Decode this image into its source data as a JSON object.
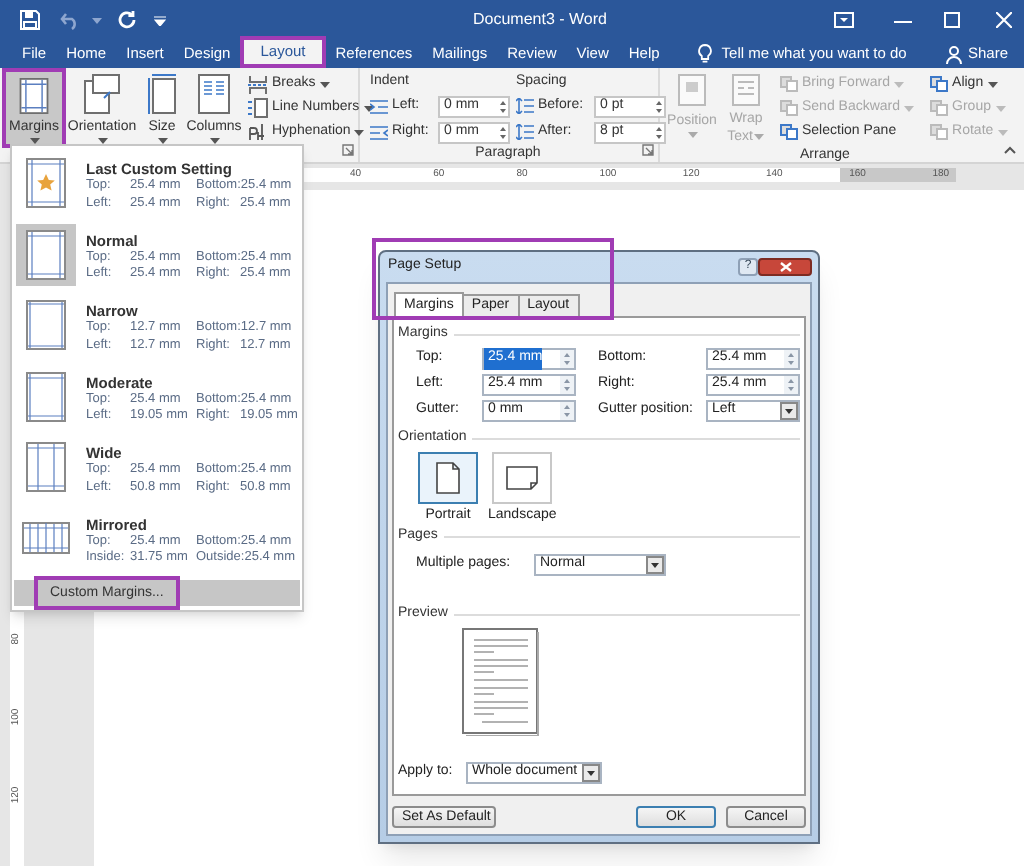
{
  "window": {
    "title": "Document3 - Word"
  },
  "ribbon_tabs": [
    {
      "label": "File",
      "selected": false,
      "highlighted": false
    },
    {
      "label": "Home",
      "selected": false,
      "highlighted": false
    },
    {
      "label": "Insert",
      "selected": false,
      "highlighted": false
    },
    {
      "label": "Design",
      "selected": false,
      "highlighted": false
    },
    {
      "label": "Layout",
      "selected": true,
      "highlighted": true
    },
    {
      "label": "References",
      "selected": false,
      "highlighted": false
    },
    {
      "label": "Mailings",
      "selected": false,
      "highlighted": false
    },
    {
      "label": "Review",
      "selected": false,
      "highlighted": false
    },
    {
      "label": "View",
      "selected": false,
      "highlighted": false
    },
    {
      "label": "Help",
      "selected": false,
      "highlighted": false
    }
  ],
  "tell_me": "Tell me what you want to do",
  "share": "Share",
  "ribbon": {
    "large_buttons": [
      {
        "label": "Margins",
        "pressed": true,
        "highlighted": true
      },
      {
        "label": "Orientation",
        "pressed": false,
        "highlighted": false
      },
      {
        "label": "Size",
        "pressed": false,
        "highlighted": false
      },
      {
        "label": "Columns",
        "pressed": false,
        "highlighted": false
      }
    ],
    "small_buttons": [
      "Breaks",
      "Line Numbers",
      "Hyphenation"
    ],
    "indent": {
      "label": "Indent",
      "left_label": "Left:",
      "left": "0 mm",
      "right_label": "Right:",
      "right": "0 mm"
    },
    "spacing": {
      "label": "Spacing",
      "before_label": "Before:",
      "before": "0 pt",
      "after_label": "After:",
      "after": "8 pt"
    },
    "paragraph_label": "Paragraph",
    "position": {
      "label": "Position",
      "disabled": true
    },
    "wrap_text": {
      "line_1": "Wrap",
      "line_2": "Text",
      "disabled": true
    },
    "arrange_buttons": [
      {
        "label": "Bring Forward",
        "disabled": true
      },
      {
        "label": "Send Backward",
        "disabled": true
      },
      {
        "label": "Selection Pane",
        "disabled": false
      },
      {
        "label": "Align",
        "disabled": false
      },
      {
        "label": "Group",
        "disabled": true
      },
      {
        "label": "Rotate",
        "disabled": true
      }
    ],
    "arrange_label": "Arrange"
  },
  "ruler": {
    "top_labels": [
      "40",
      "60",
      "80",
      "100",
      "120",
      "140",
      "160",
      "180"
    ],
    "side_labels": [
      "80",
      "100",
      "120"
    ]
  },
  "margins_menu": {
    "items": [
      {
        "title": "Last Custom Setting",
        "selected": false,
        "rows": [
          [
            "Top:",
            "25.4 mm",
            "Bottom:",
            "25.4 mm"
          ],
          [
            "Left:",
            "25.4 mm",
            "Right:",
            "25.4 mm"
          ]
        ]
      },
      {
        "title": "Normal",
        "selected": true,
        "rows": [
          [
            "Top:",
            "25.4 mm",
            "Bottom:",
            "25.4 mm"
          ],
          [
            "Left:",
            "25.4 mm",
            "Right:",
            "25.4 mm"
          ]
        ]
      },
      {
        "title": "Narrow",
        "selected": false,
        "rows": [
          [
            "Top:",
            "12.7 mm",
            "Bottom:",
            "12.7 mm"
          ],
          [
            "Left:",
            "12.7 mm",
            "Right:",
            "12.7 mm"
          ]
        ]
      },
      {
        "title": "Moderate",
        "selected": false,
        "rows": [
          [
            "Top:",
            "25.4 mm",
            "Bottom:",
            "25.4 mm"
          ],
          [
            "Left:",
            "19.05 mm",
            "Right:",
            "19.05 mm"
          ]
        ]
      },
      {
        "title": "Wide",
        "selected": false,
        "rows": [
          [
            "Top:",
            "25.4 mm",
            "Bottom:",
            "25.4 mm"
          ],
          [
            "Left:",
            "50.8 mm",
            "Right:",
            "50.8 mm"
          ]
        ]
      },
      {
        "title": "Mirrored",
        "selected": false,
        "rows": [
          [
            "Top:",
            "25.4 mm",
            "Bottom:",
            "25.4 mm"
          ],
          [
            "Inside:",
            "31.75 mm",
            "Outside:",
            "25.4 mm"
          ]
        ]
      }
    ],
    "custom": {
      "label": "Custom Margins...",
      "highlighted": true
    }
  },
  "dialog": {
    "title": "Page Setup",
    "help": "?",
    "highlighted": true,
    "tabs": [
      {
        "label": "Margins",
        "selected": true
      },
      {
        "label": "Paper",
        "selected": false
      },
      {
        "label": "Layout",
        "selected": false
      }
    ],
    "margins_section": "Margins",
    "fields": [
      {
        "label": "Top:",
        "value": "25.4 mm",
        "kind": "spin",
        "text_selected": true
      },
      {
        "label": "Bottom:",
        "value": "25.4 mm",
        "kind": "spin",
        "text_selected": false
      },
      {
        "label": "Left:",
        "value": "25.4 mm",
        "kind": "spin",
        "text_selected": false
      },
      {
        "label": "Right:",
        "value": "25.4 mm",
        "kind": "spin",
        "text_selected": false
      },
      {
        "label": "Gutter:",
        "value": "0 mm",
        "kind": "spin",
        "text_selected": false
      },
      {
        "label": "Gutter position:",
        "value": "Left",
        "kind": "dropdown",
        "text_selected": false
      }
    ],
    "orientation_section": "Orientation",
    "orientations": [
      {
        "label": "Portrait",
        "selected": true
      },
      {
        "label": "Landscape",
        "selected": false
      }
    ],
    "pages_section": "Pages",
    "multiple_pages": {
      "label": "Multiple pages:",
      "value": "Normal"
    },
    "preview_section": "Preview",
    "apply_to": {
      "label": "Apply to:",
      "value": "Whole document"
    },
    "buttons": [
      {
        "label": "Set As Default",
        "default": false
      },
      {
        "label": "OK",
        "default": true
      },
      {
        "label": "Cancel",
        "default": false
      }
    ]
  }
}
